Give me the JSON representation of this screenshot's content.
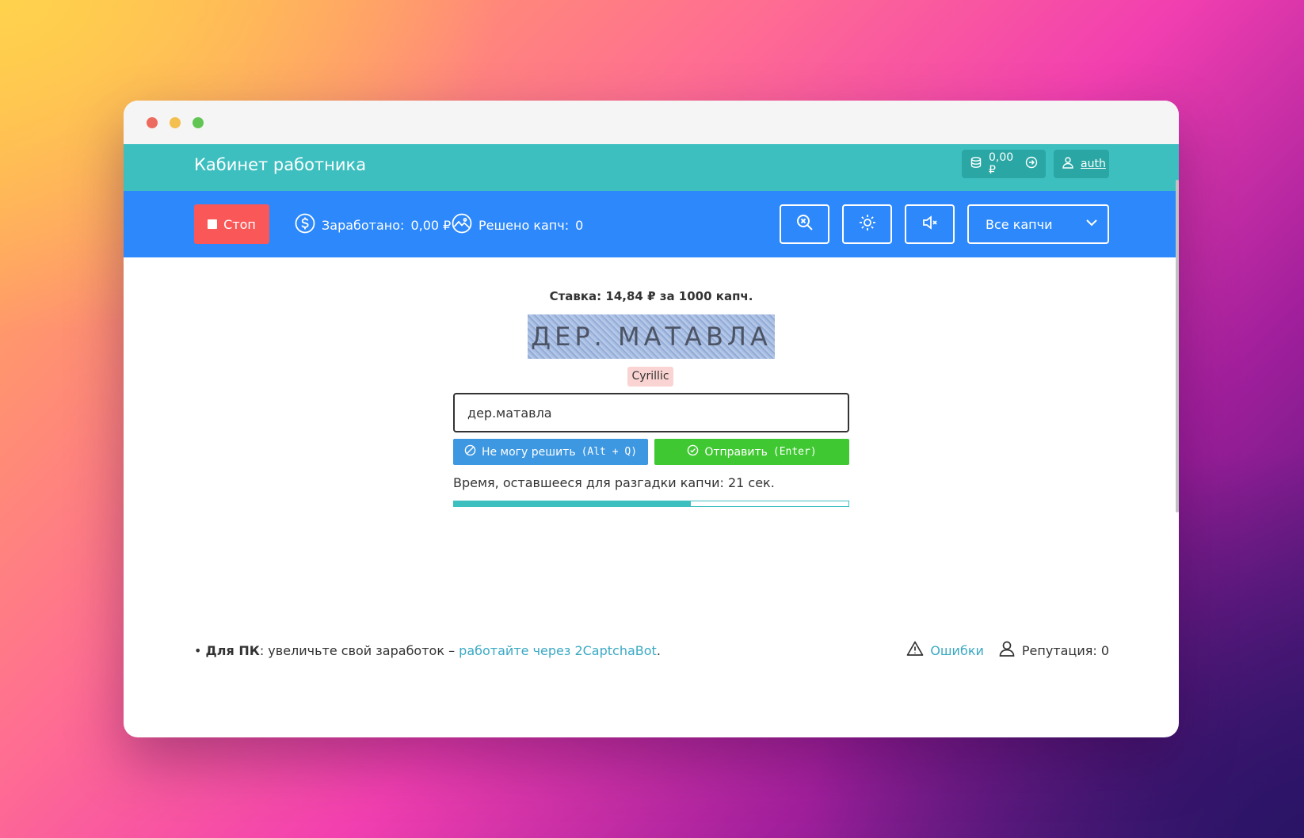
{
  "header": {
    "title": "Кабинет работника",
    "balance": "0,00 ₽",
    "user_label": "auth"
  },
  "toolbar": {
    "stop_label": "Стоп",
    "earned_label": "Заработано:",
    "earned_value": "0,00 ₽",
    "solved_label": "Решено капч:",
    "solved_value": "0",
    "select_value": "Все капчи"
  },
  "task": {
    "rate_text": "Ставка: 14,84 ₽ за 1000 капч.",
    "captcha_text": "ДЕР. МАТАВЛА",
    "lang_badge": "Cyrillic",
    "answer_value": "дер.матавла",
    "cant_solve_label": "Не могу решить",
    "cant_solve_hotkey": "(Alt + Q)",
    "send_label": "Отправить",
    "send_hotkey": "(Enter)",
    "timer_text": "Время, оставшееся для разгадки капчи: 21 сек.",
    "progress_fraction": 0.6
  },
  "footer": {
    "pc_bold": "Для ПК",
    "pc_text": ": увеличьте свой заработок – ",
    "pc_link": "работайте через 2CaptchaBot",
    "pc_end": ".",
    "errors_link": "Ошибки",
    "reputation": "Репутация: 0"
  },
  "colors": {
    "topbar": "#3dbfc0",
    "toolbar": "#2c88fb",
    "stop_button": "#fa5858",
    "cant_button": "#3d97e1",
    "send_button": "#40c832",
    "link": "#3aa9c4"
  }
}
